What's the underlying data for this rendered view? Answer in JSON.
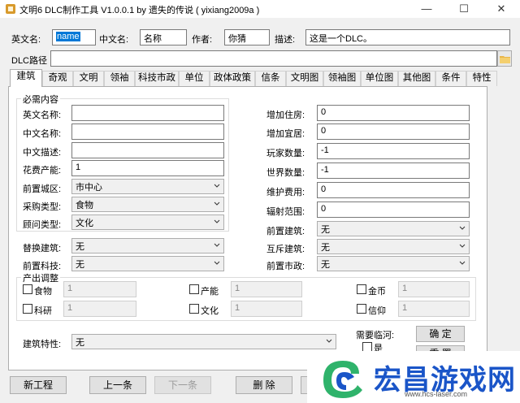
{
  "window": {
    "title": "文明6 DLC制作工具 V1.0.0.1 by 遗失的传说 ( yixiang2009a )",
    "minimize": "—",
    "maximize": "☐",
    "close": "✕"
  },
  "meta": {
    "eng_name_label": "英文名:",
    "eng_name_value": "name",
    "cn_name_label": "中文名:",
    "cn_name_value": "名称",
    "author_label": "作者:",
    "author_value": "你猜",
    "desc_label": "描述:",
    "desc_value": "这是一个DLC。",
    "dlc_path_label": "DLC路径",
    "dlc_path_value": ""
  },
  "tabs": [
    "建筑",
    "奇观",
    "文明",
    "领袖",
    "科技市政",
    "单位",
    "政体政策",
    "信条",
    "文明图",
    "领袖图",
    "单位图",
    "其他图",
    "条件",
    "特性"
  ],
  "required": {
    "title": "必需内容",
    "eng_name_label": "英文名称:",
    "eng_name_value": "",
    "cn_name_label": "中文名称:",
    "cn_name_value": "",
    "cn_desc_label": "中文描述:",
    "cn_desc_value": "",
    "cost_label": "花费产能:",
    "cost_value": "1",
    "pre_district_label": "前置城区:",
    "pre_district_value": "市中心",
    "purchase_label": "采购类型:",
    "purchase_value": "食物",
    "advisor_label": "顾问类型:",
    "advisor_value": "文化"
  },
  "right": {
    "housing_label": "增加住房:",
    "housing_value": "0",
    "amenity_label": "增加宜居:",
    "amenity_value": "0",
    "min_players_label": "玩家数量:",
    "min_players_value": "-1",
    "world_players_label": "世界数量:",
    "world_players_value": "-1",
    "maintenance_label": "维护费用:",
    "maintenance_value": "0",
    "radius_label": "辐射范围:",
    "radius_value": "0",
    "pre_building_label": "前置建筑:",
    "pre_building_value": "无",
    "mutex_label": "互斥建筑:",
    "mutex_value": "无",
    "pre_civic_label": "前置市政:",
    "pre_civic_value": "无"
  },
  "left_extra": {
    "replace_label": "替换建筑:",
    "replace_value": "无",
    "pre_tech_label": "前置科技:",
    "pre_tech_value": "无"
  },
  "output": {
    "title": "产出调整",
    "items": [
      {
        "label": "食物",
        "value": "1"
      },
      {
        "label": "产能",
        "value": "1"
      },
      {
        "label": "金币",
        "value": "1"
      },
      {
        "label": "科研",
        "value": "1"
      },
      {
        "label": "文化",
        "value": "1"
      },
      {
        "label": "信仰",
        "value": "1"
      }
    ]
  },
  "feature": {
    "label": "建筑特性:",
    "value": "无"
  },
  "coast": {
    "label": "需要临河:",
    "check_label": "是"
  },
  "buttons": {
    "confirm": "确 定",
    "reset": "重 置",
    "new": "新工程",
    "prev": "上一条",
    "next": "下一条",
    "delete": "删 除"
  },
  "watermark": {
    "brand": "宏昌游戏网",
    "url": "www.hcs-laser.com"
  },
  "colors": {
    "accent": "#0078d7",
    "brand_blue": "#1a55c8",
    "logo_green": "#2fb36b"
  }
}
